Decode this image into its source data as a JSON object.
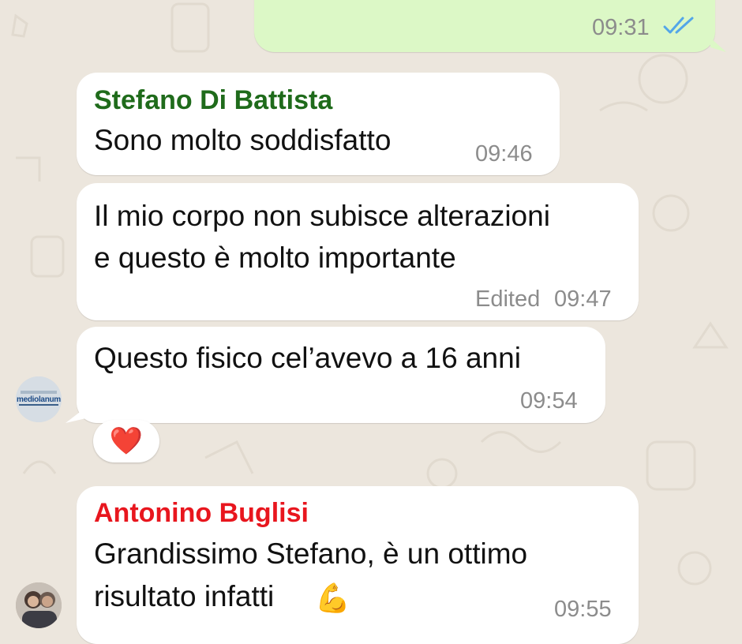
{
  "colors": {
    "background": "#ece6dd",
    "incoming_bubble": "#ffffff",
    "outgoing_bubble": "#dcf8c6",
    "sender_stefano": "#1f6b1b",
    "sender_antonino": "#e8161e",
    "timestamp": "#8c8c8c",
    "read_ticks": "#53a6e8"
  },
  "messages": [
    {
      "direction": "outgoing",
      "time": "09:31",
      "status_icon": "double-check-read-icon"
    },
    {
      "direction": "incoming",
      "sender": "Stefano Di Battista",
      "lines": [
        "Sono molto soddisfatto"
      ],
      "time": "09:46"
    },
    {
      "direction": "incoming",
      "lines": [
        "Il mio corpo non subisce alterazioni",
        "e questo è molto importante"
      ],
      "edited_label": "Edited",
      "time": "09:47"
    },
    {
      "direction": "incoming",
      "lines": [
        "Questo fisico cel’avevo a 16 anni"
      ],
      "time": "09:54",
      "avatar_text": "mediolanum",
      "reaction": "❤️"
    },
    {
      "direction": "incoming",
      "sender": "Antonino Buglisi",
      "lines": [
        "Grandissimo Stefano, è un ottimo",
        "risultato infatti"
      ],
      "emoji": "💪",
      "time": "09:55",
      "avatar_icon": "user-photo-avatar"
    }
  ]
}
